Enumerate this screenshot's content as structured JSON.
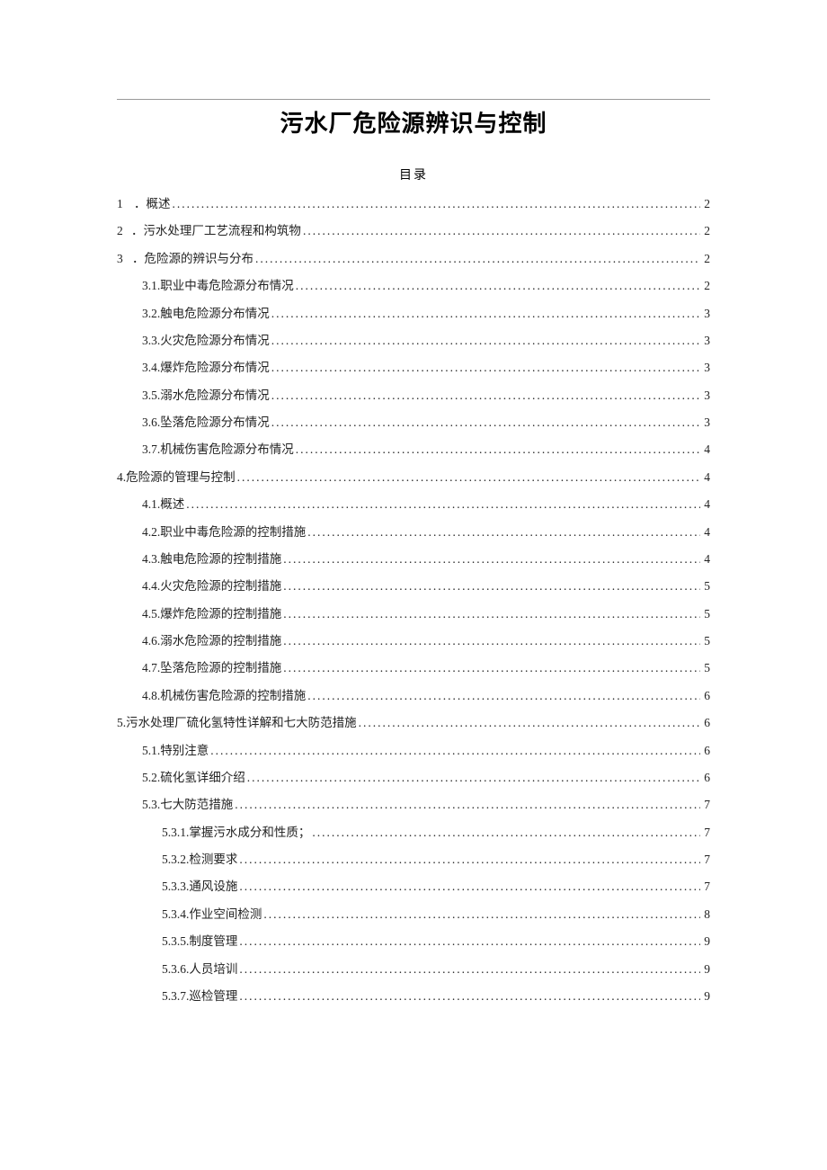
{
  "title": "污水厂危险源辨识与控制",
  "toc_heading": "目录",
  "toc": [
    {
      "num": "1",
      "sep": "．",
      "label": "概述",
      "page": "2",
      "indent": 0,
      "gap": true,
      "trail": true
    },
    {
      "num": "2",
      "sep": "．",
      "label": "污水处理厂工艺流程和构筑物",
      "page": "2",
      "indent": 0,
      "gap": true,
      "trail": true
    },
    {
      "num": "3",
      "sep": "．",
      "label": "危险源的辨识与分布",
      "page": "2",
      "indent": 0,
      "gap": true,
      "trail": true
    },
    {
      "num": "3.1.",
      "sep": "",
      "label": "职业中毒危险源分布情况 ",
      "page": "2",
      "indent": 1,
      "gap": false,
      "trail": false
    },
    {
      "num": "3.2.",
      "sep": "",
      "label": "触电危险源分布情况 ",
      "page": "3",
      "indent": 1,
      "gap": false,
      "trail": false
    },
    {
      "num": "3.3.",
      "sep": "",
      "label": "火灾危险源分布情况 ",
      "page": "3",
      "indent": 1,
      "gap": false,
      "trail": false
    },
    {
      "num": "3.4.",
      "sep": "",
      "label": "爆炸危险源分布情况 ",
      "page": "3",
      "indent": 1,
      "gap": false,
      "trail": false
    },
    {
      "num": "3.5.",
      "sep": "",
      "label": "溺水危险源分布情况 ",
      "page": "3",
      "indent": 1,
      "gap": false,
      "trail": false
    },
    {
      "num": "3.6.",
      "sep": "",
      "label": "坠落危险源分布情况 ",
      "page": "3",
      "indent": 1,
      "gap": false,
      "trail": false
    },
    {
      "num": "3.7.",
      "sep": "",
      "label": "机械伤害危险源分布情况 ",
      "page": "4",
      "indent": 1,
      "gap": false,
      "trail": false
    },
    {
      "num": "4.",
      "sep": "",
      "label": "危险源的管理与控制",
      "page": "4",
      "indent": 0,
      "gap": false,
      "trail": true
    },
    {
      "num": "4.1.",
      "sep": "",
      "label": "概述 ",
      "page": "4",
      "indent": 1,
      "gap": false,
      "trail": false
    },
    {
      "num": "4.2.",
      "sep": "",
      "label": "职业中毒危险源的控制措施 ",
      "page": "4",
      "indent": 1,
      "gap": false,
      "trail": false
    },
    {
      "num": "4.3.",
      "sep": "",
      "label": "触电危险源的控制措施 ",
      "page": "4",
      "indent": 1,
      "gap": false,
      "trail": false
    },
    {
      "num": "4.4.",
      "sep": "",
      "label": "火灾危险源的控制措施 ",
      "page": "5",
      "indent": 1,
      "gap": false,
      "trail": false
    },
    {
      "num": "4.5.",
      "sep": "",
      "label": "爆炸危险源的控制措施 ",
      "page": "5",
      "indent": 1,
      "gap": false,
      "trail": false
    },
    {
      "num": "4.6.",
      "sep": "",
      "label": "溺水危险源的控制措施 ",
      "page": "5",
      "indent": 1,
      "gap": false,
      "trail": false
    },
    {
      "num": "4.7.",
      "sep": "",
      "label": "坠落危险源的控制措施 ",
      "page": "5",
      "indent": 1,
      "gap": false,
      "trail": false
    },
    {
      "num": "4.",
      "sep": " ",
      "label": "8.机械伤害危险源的控制措施 ",
      "page": "6",
      "indent": 1,
      "gap": false,
      "trail": false
    },
    {
      "num": "5.",
      "sep": "",
      "label": "污水处理厂硫化氢特性详解和七大防范措施",
      "page": "6",
      "indent": 0,
      "gap": false,
      "trail": true
    },
    {
      "num": "5.",
      "sep": " ",
      "label": "1.特别注意 ",
      "page": "6",
      "indent": 1,
      "gap": false,
      "trail": false
    },
    {
      "num": "5.2.",
      "sep": "  ",
      "label": "硫化氢详细介绍 ",
      "page": "6",
      "indent": 1,
      "gap": false,
      "trail": false
    },
    {
      "num": "5.",
      "sep": " ",
      "label": "3.七大防范措施 ",
      "page": "7",
      "indent": 1,
      "gap": false,
      "trail": false
    },
    {
      "num": "5.3.",
      "sep": " ",
      "label": "1.掌握污水成分和性质； ",
      "page": "7",
      "indent": 2,
      "gap": false,
      "trail": false
    },
    {
      "num": "5.3.2.",
      "sep": "  ",
      "label": "检测要求 ",
      "page": "7",
      "indent": 2,
      "gap": false,
      "trail": false
    },
    {
      "num": "5.3.3.",
      "sep": "",
      "label": "通风设施 ",
      "page": "7",
      "indent": 2,
      "gap": false,
      "trail": false
    },
    {
      "num": "5.3.4.",
      "sep": "",
      "label": "作业空间检测 ",
      "page": "8",
      "indent": 2,
      "gap": false,
      "trail": false
    },
    {
      "num": "5.3.5.",
      "sep": "",
      "label": "制度管理 ",
      "page": "9",
      "indent": 2,
      "gap": false,
      "trail": false
    },
    {
      "num": "5.3.6.",
      "sep": "  ",
      "label": "人员培训 ",
      "page": "9",
      "indent": 2,
      "gap": false,
      "trail": false
    },
    {
      "num": "5.3.7.",
      "sep": "  ",
      "label": "巡检管理 ",
      "page": "9",
      "indent": 2,
      "gap": false,
      "trail": false
    }
  ]
}
